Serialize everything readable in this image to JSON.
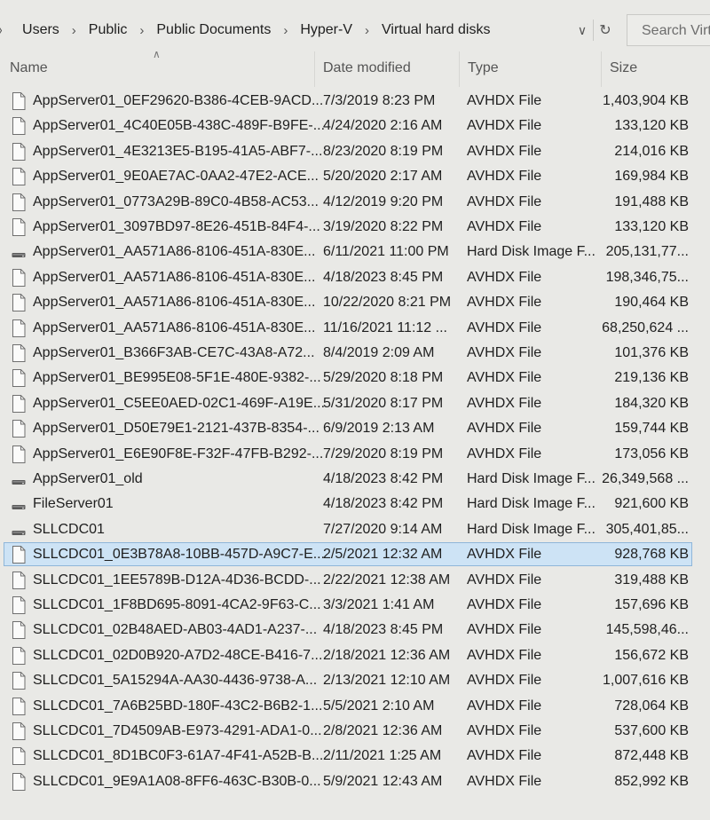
{
  "address": {
    "lead": "〉",
    "crumbs": [
      "Users",
      "Public",
      "Public Documents",
      "Hyper-V",
      "Virtual hard disks"
    ],
    "search_placeholder": "Search Virtu"
  },
  "columns": {
    "name": "Name",
    "date": "Date modified",
    "type": "Type",
    "size": "Size"
  },
  "files": [
    {
      "name": "AppServer01_0EF29620-B386-4CEB-9ACD...",
      "date": "7/3/2019 8:23 PM",
      "type": "AVHDX File",
      "size": "1,403,904 KB",
      "icon": "document-icon"
    },
    {
      "name": "AppServer01_4C40E05B-438C-489F-B9FE-...",
      "date": "4/24/2020 2:16 AM",
      "type": "AVHDX File",
      "size": "133,120 KB",
      "icon": "document-icon"
    },
    {
      "name": "AppServer01_4E3213E5-B195-41A5-ABF7-...",
      "date": "8/23/2020 8:19 PM",
      "type": "AVHDX File",
      "size": "214,016 KB",
      "icon": "document-icon"
    },
    {
      "name": "AppServer01_9E0AE7AC-0AA2-47E2-ACE...",
      "date": "5/20/2020 2:17 AM",
      "type": "AVHDX File",
      "size": "169,984 KB",
      "icon": "document-icon"
    },
    {
      "name": "AppServer01_0773A29B-89C0-4B58-AC53...",
      "date": "4/12/2019 9:20 PM",
      "type": "AVHDX File",
      "size": "191,488 KB",
      "icon": "document-icon"
    },
    {
      "name": "AppServer01_3097BD97-8E26-451B-84F4-...",
      "date": "3/19/2020 8:22 PM",
      "type": "AVHDX File",
      "size": "133,120 KB",
      "icon": "document-icon"
    },
    {
      "name": "AppServer01_AA571A86-8106-451A-830E...",
      "date": "6/11/2021 11:00 PM",
      "type": "Hard Disk Image F...",
      "size": "205,131,77...",
      "icon": "disk-icon"
    },
    {
      "name": "AppServer01_AA571A86-8106-451A-830E...",
      "date": "4/18/2023 8:45 PM",
      "type": "AVHDX File",
      "size": "198,346,75...",
      "icon": "document-icon"
    },
    {
      "name": "AppServer01_AA571A86-8106-451A-830E...",
      "date": "10/22/2020 8:21 PM",
      "type": "AVHDX File",
      "size": "190,464 KB",
      "icon": "document-icon"
    },
    {
      "name": "AppServer01_AA571A86-8106-451A-830E...",
      "date": "11/16/2021 11:12 ...",
      "type": "AVHDX File",
      "size": "68,250,624 ...",
      "icon": "document-icon"
    },
    {
      "name": "AppServer01_B366F3AB-CE7C-43A8-A72...",
      "date": "8/4/2019 2:09 AM",
      "type": "AVHDX File",
      "size": "101,376 KB",
      "icon": "document-icon"
    },
    {
      "name": "AppServer01_BE995E08-5F1E-480E-9382-...",
      "date": "5/29/2020 8:18 PM",
      "type": "AVHDX File",
      "size": "219,136 KB",
      "icon": "document-icon"
    },
    {
      "name": "AppServer01_C5EE0AED-02C1-469F-A19E...",
      "date": "5/31/2020 8:17 PM",
      "type": "AVHDX File",
      "size": "184,320 KB",
      "icon": "document-icon"
    },
    {
      "name": "AppServer01_D50E79E1-2121-437B-8354-...",
      "date": "6/9/2019 2:13 AM",
      "type": "AVHDX File",
      "size": "159,744 KB",
      "icon": "document-icon"
    },
    {
      "name": "AppServer01_E6E90F8E-F32F-47FB-B292-...",
      "date": "7/29/2020 8:19 PM",
      "type": "AVHDX File",
      "size": "173,056 KB",
      "icon": "document-icon"
    },
    {
      "name": "AppServer01_old",
      "date": "4/18/2023 8:42 PM",
      "type": "Hard Disk Image F...",
      "size": "26,349,568 ...",
      "icon": "disk-icon"
    },
    {
      "name": "FileServer01",
      "date": "4/18/2023 8:42 PM",
      "type": "Hard Disk Image F...",
      "size": "921,600 KB",
      "icon": "disk-icon"
    },
    {
      "name": "SLLCDC01",
      "date": "7/27/2020 9:14 AM",
      "type": "Hard Disk Image F...",
      "size": "305,401,85...",
      "icon": "disk-icon"
    },
    {
      "name": "SLLCDC01_0E3B78A8-10BB-457D-A9C7-E...",
      "date": "2/5/2021 12:32 AM",
      "type": "AVHDX File",
      "size": "928,768 KB",
      "icon": "document-icon",
      "selected": true
    },
    {
      "name": "SLLCDC01_1EE5789B-D12A-4D36-BCDD-...",
      "date": "2/22/2021 12:38 AM",
      "type": "AVHDX File",
      "size": "319,488 KB",
      "icon": "document-icon"
    },
    {
      "name": "SLLCDC01_1F8BD695-8091-4CA2-9F63-C...",
      "date": "3/3/2021 1:41 AM",
      "type": "AVHDX File",
      "size": "157,696 KB",
      "icon": "document-icon"
    },
    {
      "name": "SLLCDC01_02B48AED-AB03-4AD1-A237-...",
      "date": "4/18/2023 8:45 PM",
      "type": "AVHDX File",
      "size": "145,598,46...",
      "icon": "document-icon"
    },
    {
      "name": "SLLCDC01_02D0B920-A7D2-48CE-B416-7...",
      "date": "2/18/2021 12:36 AM",
      "type": "AVHDX File",
      "size": "156,672 KB",
      "icon": "document-icon"
    },
    {
      "name": "SLLCDC01_5A15294A-AA30-4436-9738-A...",
      "date": "2/13/2021 12:10 AM",
      "type": "AVHDX File",
      "size": "1,007,616 KB",
      "icon": "document-icon"
    },
    {
      "name": "SLLCDC01_7A6B25BD-180F-43C2-B6B2-1...",
      "date": "5/5/2021 2:10 AM",
      "type": "AVHDX File",
      "size": "728,064 KB",
      "icon": "document-icon"
    },
    {
      "name": "SLLCDC01_7D4509AB-E973-4291-ADA1-0...",
      "date": "2/8/2021 12:36 AM",
      "type": "AVHDX File",
      "size": "537,600 KB",
      "icon": "document-icon"
    },
    {
      "name": "SLLCDC01_8D1BC0F3-61A7-4F41-A52B-B...",
      "date": "2/11/2021 1:25 AM",
      "type": "AVHDX File",
      "size": "872,448 KB",
      "icon": "document-icon"
    },
    {
      "name": "SLLCDC01_9E9A1A08-8FF6-463C-B30B-0...",
      "date": "5/9/2021 12:43 AM",
      "type": "AVHDX File",
      "size": "852,992 KB",
      "icon": "document-icon"
    }
  ]
}
